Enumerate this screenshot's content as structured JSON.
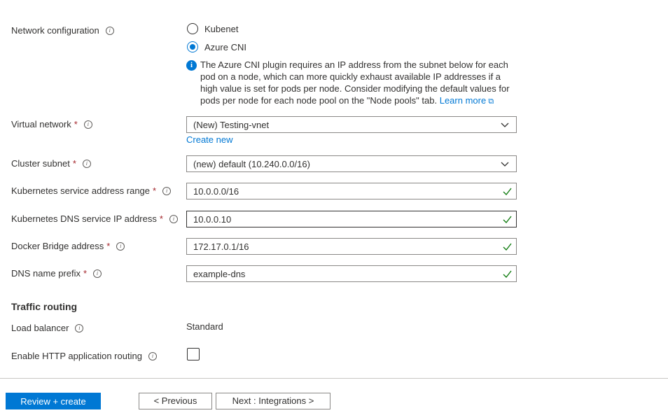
{
  "network_config": {
    "label": "Network configuration",
    "options": [
      {
        "label": "Kubenet",
        "selected": false
      },
      {
        "label": "Azure CNI",
        "selected": true
      }
    ],
    "info_text": "The Azure CNI plugin requires an IP address from the subnet below for each pod on a node, which can more quickly exhaust available IP addresses if a high value is set for pods per node. Consider modifying the default values for pods per node for each node pool on the \"Node pools\" tab.",
    "learn_more": "Learn more"
  },
  "virtual_network": {
    "label": "Virtual network",
    "value": "(New) Testing-vnet",
    "create_new": "Create new"
  },
  "cluster_subnet": {
    "label": "Cluster subnet",
    "value": "(new) default (10.240.0.0/16)"
  },
  "service_range": {
    "label": "Kubernetes service address range",
    "value": "10.0.0.0/16"
  },
  "dns_ip": {
    "label": "Kubernetes DNS service IP address",
    "value": "10.0.0.10"
  },
  "docker_bridge": {
    "label": "Docker Bridge address",
    "value": "172.17.0.1/16"
  },
  "dns_prefix": {
    "label": "DNS name prefix",
    "value": "example-dns"
  },
  "traffic_routing": {
    "title": "Traffic routing",
    "load_balancer_label": "Load balancer",
    "load_balancer_value": "Standard",
    "http_routing_label": "Enable HTTP application routing",
    "http_routing_checked": false
  },
  "required_mark": "*",
  "footer": {
    "review_create": "Review + create",
    "previous": "< Previous",
    "next": "Next : Integrations >"
  },
  "colors": {
    "accent": "#0078d4",
    "valid": "#107c10",
    "required": "#a4262c"
  }
}
